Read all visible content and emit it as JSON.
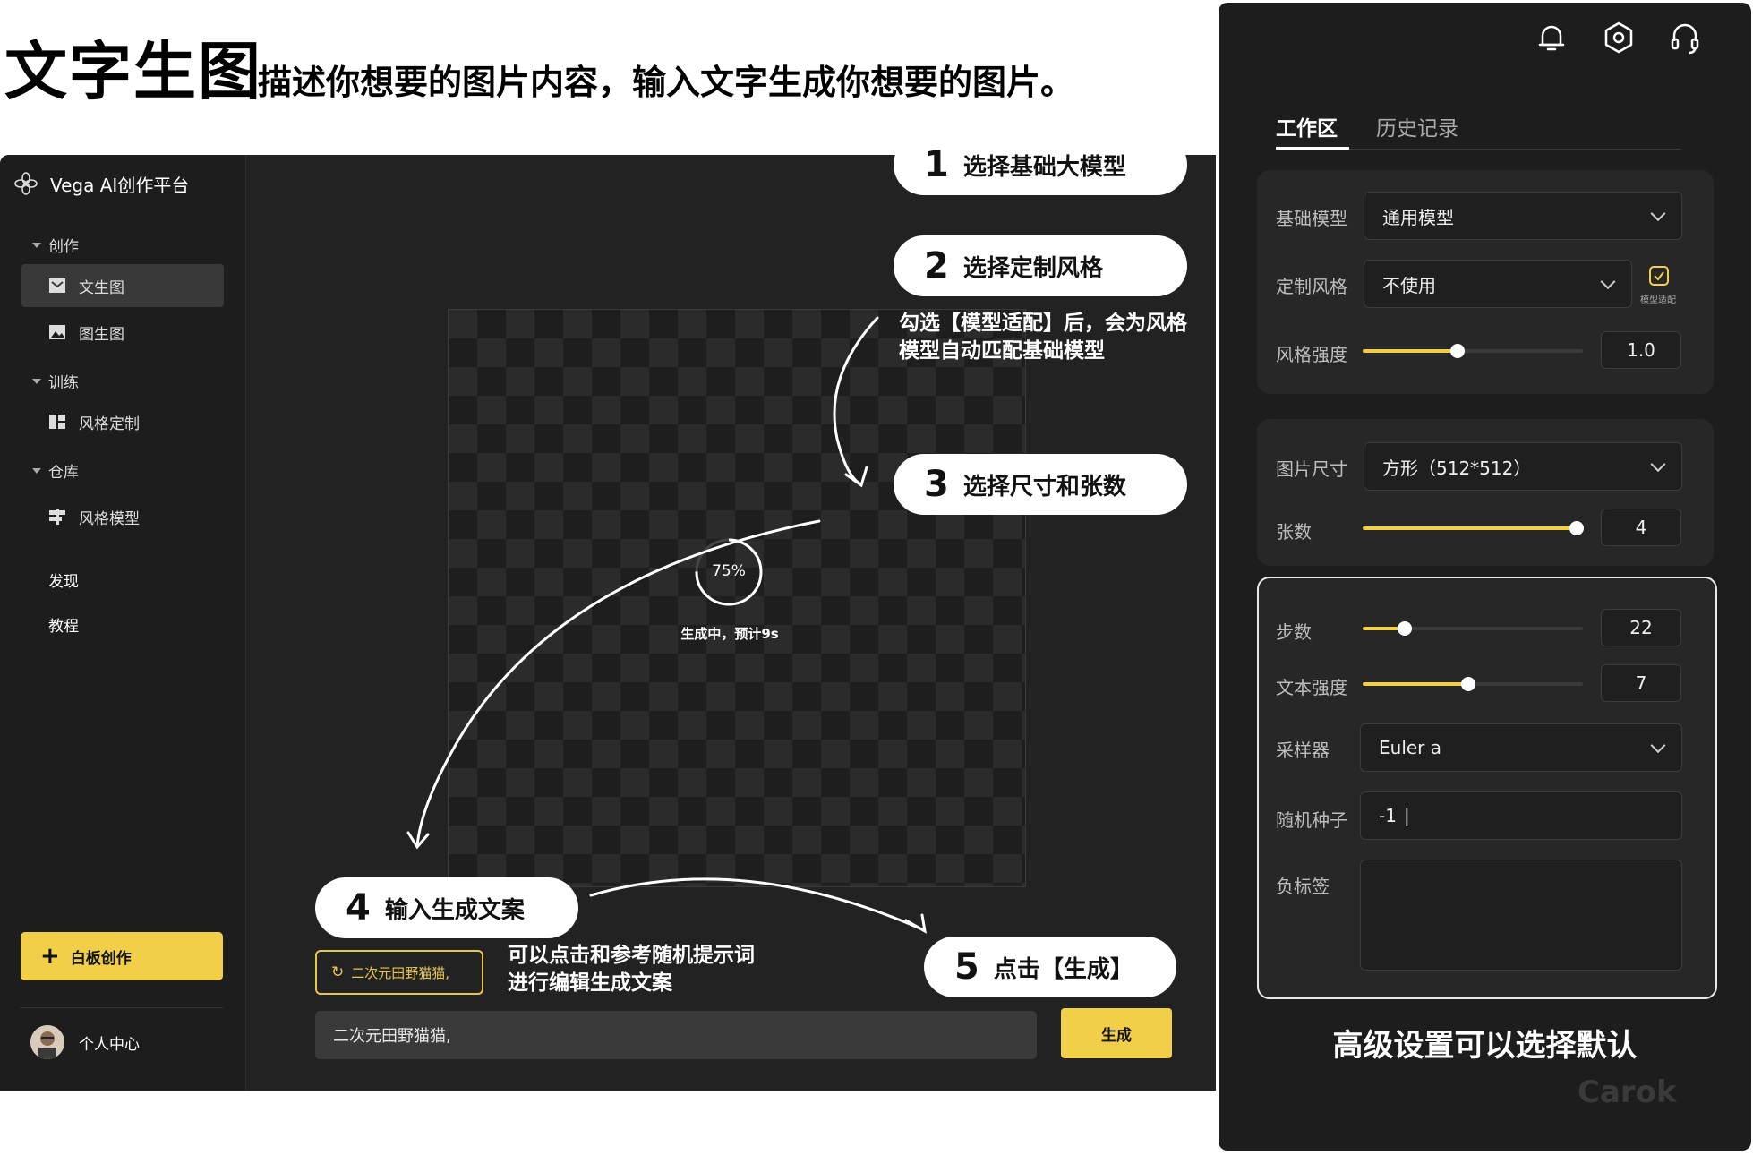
{
  "header": {
    "title": "文字生图",
    "description": "描述你想要的图片内容，输入文字生成你想要的图片。"
  },
  "app": {
    "brand": "Vega AI创作平台",
    "sections": {
      "create": "创作",
      "train": "训练",
      "warehouse": "仓库"
    },
    "nav": {
      "text_to_image": "文生图",
      "image_to_image": "图生图",
      "style_custom": "风格定制",
      "style_model": "风格模型",
      "discover": "发现",
      "tutorial": "教程"
    },
    "whiteboard_button": "白板创作",
    "profile": "个人中心",
    "progress": {
      "percent": "75%",
      "status": "生成中，预计9s"
    },
    "suggestion_chip": "二次元田野猫猫,",
    "prompt_value": "二次元田野猫猫,",
    "generate_button": "生成"
  },
  "callouts": {
    "step1": {
      "num": "1",
      "text": "选择基础大模型"
    },
    "step2": {
      "num": "2",
      "text": "选择定制风格"
    },
    "step3": {
      "num": "3",
      "text": "选择尺寸和张数"
    },
    "step4": {
      "num": "4",
      "text": "输入生成文案"
    },
    "step5": {
      "num": "5",
      "text": "点击【生成】"
    },
    "note_match_line1": "勾选【模型适配】后，会为风格",
    "note_match_line2": "模型自动匹配基础模型",
    "note_prompt_line1": "可以点击和参考随机提示词",
    "note_prompt_line2": "进行编辑生成文案"
  },
  "panel": {
    "icons": [
      "bell-icon",
      "settings-hex-icon",
      "headset-icon"
    ],
    "tabs": {
      "workspace": "工作区",
      "history": "历史记录"
    },
    "base_model": {
      "label": "基础模型",
      "value": "通用模型"
    },
    "custom_style": {
      "label": "定制风格",
      "value": "不使用",
      "checkbox_label": "模型适配",
      "checked": true
    },
    "style_strength": {
      "label": "风格强度",
      "value": "1.0",
      "fraction": 0.43
    },
    "image_size": {
      "label": "图片尺寸",
      "value": "方形（512*512）"
    },
    "count": {
      "label": "张数",
      "value": "4",
      "fraction": 0.97
    },
    "steps": {
      "label": "步数",
      "value": "22",
      "fraction": 0.19
    },
    "text_strength": {
      "label": "文本强度",
      "value": "7",
      "fraction": 0.48
    },
    "sampler": {
      "label": "采样器",
      "value": "Euler a"
    },
    "seed": {
      "label": "随机种子",
      "value": "-1"
    },
    "negative": {
      "label": "负标签",
      "value": ""
    },
    "advanced_caption": "高级设置可以选择默认",
    "watermark": "Carok"
  },
  "colors": {
    "accent": "#f2cf49",
    "app_bg": "#222222",
    "panel_bg": "#1d1d1d"
  }
}
